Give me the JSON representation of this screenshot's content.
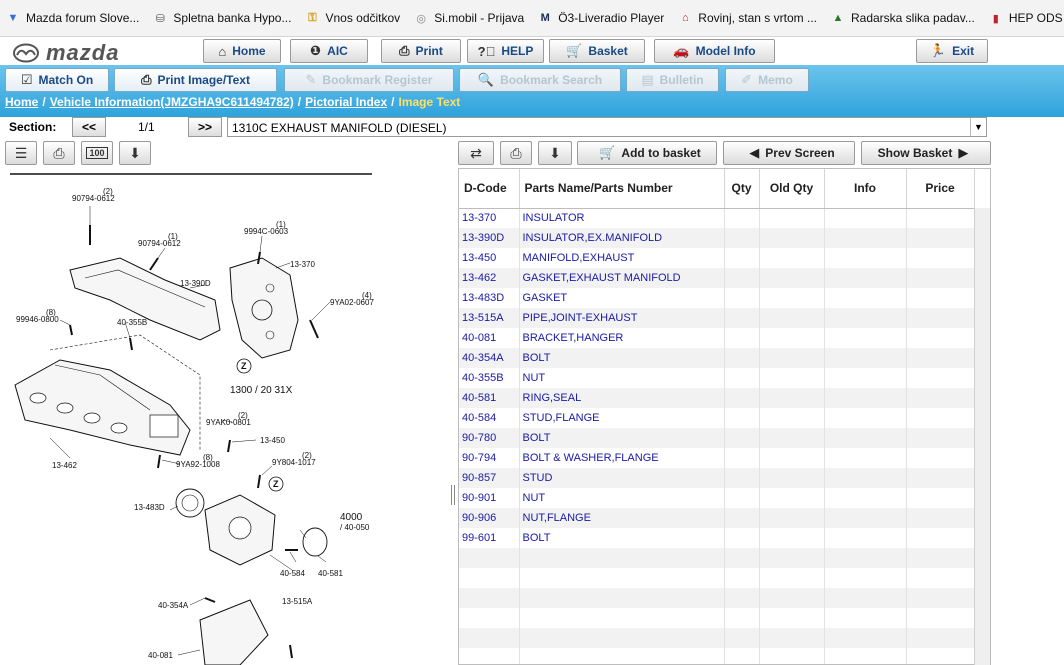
{
  "bookmarks": [
    {
      "label": "Mazda forum Slove...",
      "icon": "mazda-forum-icon",
      "color": "#3a6fd8"
    },
    {
      "label": "Spletna banka Hypo...",
      "icon": "bank-icon",
      "color": "#555555"
    },
    {
      "label": "Vnos odčitkov",
      "icon": "key-icon",
      "color": "#d4a017"
    },
    {
      "label": "Si.mobil - Prijava",
      "icon": "simobil-icon",
      "color": "#888888"
    },
    {
      "label": "Ö3-Liveradio Player",
      "icon": "radio-icon",
      "color": "#1a2a5a"
    },
    {
      "label": "Rovinj, stan s vrtom ...",
      "icon": "house-icon",
      "color": "#c0202a"
    },
    {
      "label": "Radarska slika padav...",
      "icon": "radar-icon",
      "color": "#2a7a2a"
    },
    {
      "label": "HEP ODS",
      "icon": "hep-icon",
      "color": "#c0202a"
    }
  ],
  "brand": {
    "name": "mazda"
  },
  "topnav": [
    {
      "label": "Home",
      "icon": "home-icon"
    },
    {
      "label": "AIC",
      "icon": "aic-icon"
    },
    {
      "label": "Print",
      "icon": "print-icon"
    },
    {
      "label": "HELP",
      "icon": "help-icon"
    },
    {
      "label": "Basket",
      "icon": "basket-icon"
    },
    {
      "label": "Model Info",
      "icon": "car-icon"
    },
    {
      "label": "Exit",
      "icon": "exit-icon"
    }
  ],
  "tabs": [
    {
      "label": "Match On",
      "icon": "check-icon",
      "enabled": true
    },
    {
      "label": "Print Image/Text",
      "icon": "print-icon",
      "enabled": true
    },
    {
      "label": "Bookmark Register",
      "icon": "bookmark-icon",
      "enabled": false
    },
    {
      "label": "Bookmark Search",
      "icon": "search-icon",
      "enabled": false
    },
    {
      "label": "Bulletin",
      "icon": "bulletin-icon",
      "enabled": false
    },
    {
      "label": "Memo",
      "icon": "memo-icon",
      "enabled": false
    }
  ],
  "breadcrumb": {
    "home": "Home",
    "vehicle": "Vehicle Information(JMZGHA9C611494782)",
    "index": "Pictorial Index",
    "current": "Image Text",
    "separator": "/"
  },
  "section": {
    "label": "Section:",
    "prev": "<<",
    "next": ">>",
    "page": "1/1",
    "selected": "1310C  EXHAUST MANIFOLD (DIESEL)"
  },
  "actions": {
    "add_to_basket": "Add to basket",
    "prev_screen": "Prev Screen",
    "show_basket": "Show Basket"
  },
  "table": {
    "columns": [
      "D-Code",
      "Parts Name/Parts Number",
      "Qty",
      "Old Qty",
      "Info",
      "Price"
    ],
    "rows": [
      {
        "code": "13-370",
        "name": "INSULATOR"
      },
      {
        "code": "13-390D",
        "name": "INSULATOR,EX.MANIFOLD"
      },
      {
        "code": "13-450",
        "name": "MANIFOLD,EXHAUST"
      },
      {
        "code": "13-462",
        "name": "GASKET,EXHAUST MANIFOLD"
      },
      {
        "code": "13-483D",
        "name": "GASKET"
      },
      {
        "code": "13-515A",
        "name": "PIPE,JOINT-EXHAUST"
      },
      {
        "code": "40-081",
        "name": "BRACKET,HANGER"
      },
      {
        "code": "40-354A",
        "name": "BOLT"
      },
      {
        "code": "40-355B",
        "name": "NUT"
      },
      {
        "code": "40-581",
        "name": "RING,SEAL"
      },
      {
        "code": "40-584",
        "name": "STUD,FLANGE"
      },
      {
        "code": "90-780",
        "name": "BOLT"
      },
      {
        "code": "90-794",
        "name": "BOLT & WASHER,FLANGE"
      },
      {
        "code": "90-857",
        "name": "STUD"
      },
      {
        "code": "90-901",
        "name": "NUT"
      },
      {
        "code": "90-906",
        "name": "NUT,FLANGE"
      },
      {
        "code": "99-601",
        "name": "BOLT"
      }
    ],
    "empty_rows": 6
  },
  "diagram": {
    "labels": [
      {
        "t": "(2)"
      },
      {
        "t": "90794-0612"
      },
      {
        "t": "(1)"
      },
      {
        "t": "90794-0612"
      },
      {
        "t": "(1)"
      },
      {
        "t": "9994C-0603"
      },
      {
        "t": "13-370"
      },
      {
        "t": "13-390D"
      },
      {
        "t": "(4)"
      },
      {
        "t": "9YA02-0607"
      },
      {
        "t": "(8)"
      },
      {
        "t": "99946-0800"
      },
      {
        "t": "40-355B"
      },
      {
        "t": "Z"
      },
      {
        "t": "1300 / 20 31X"
      },
      {
        "t": "(2)"
      },
      {
        "t": "9YAK0-0801"
      },
      {
        "t": "13-450"
      },
      {
        "t": "(8)"
      },
      {
        "t": "9YA92-1008"
      },
      {
        "t": "13-462"
      },
      {
        "t": "(2)"
      },
      {
        "t": "9Y804-1017"
      },
      {
        "t": "Z"
      },
      {
        "t": "13-483D"
      },
      {
        "t": "4000"
      },
      {
        "t": "/ 40-050"
      },
      {
        "t": "40-584"
      },
      {
        "t": "40-581"
      },
      {
        "t": "13-515A"
      },
      {
        "t": "40-354A"
      },
      {
        "t": "40-081"
      }
    ]
  },
  "colors": {
    "accent": "#2ea3dc",
    "link": "#1a1aa6",
    "nav_text": "#1a4a86",
    "crumb_current": "#ffe066"
  }
}
